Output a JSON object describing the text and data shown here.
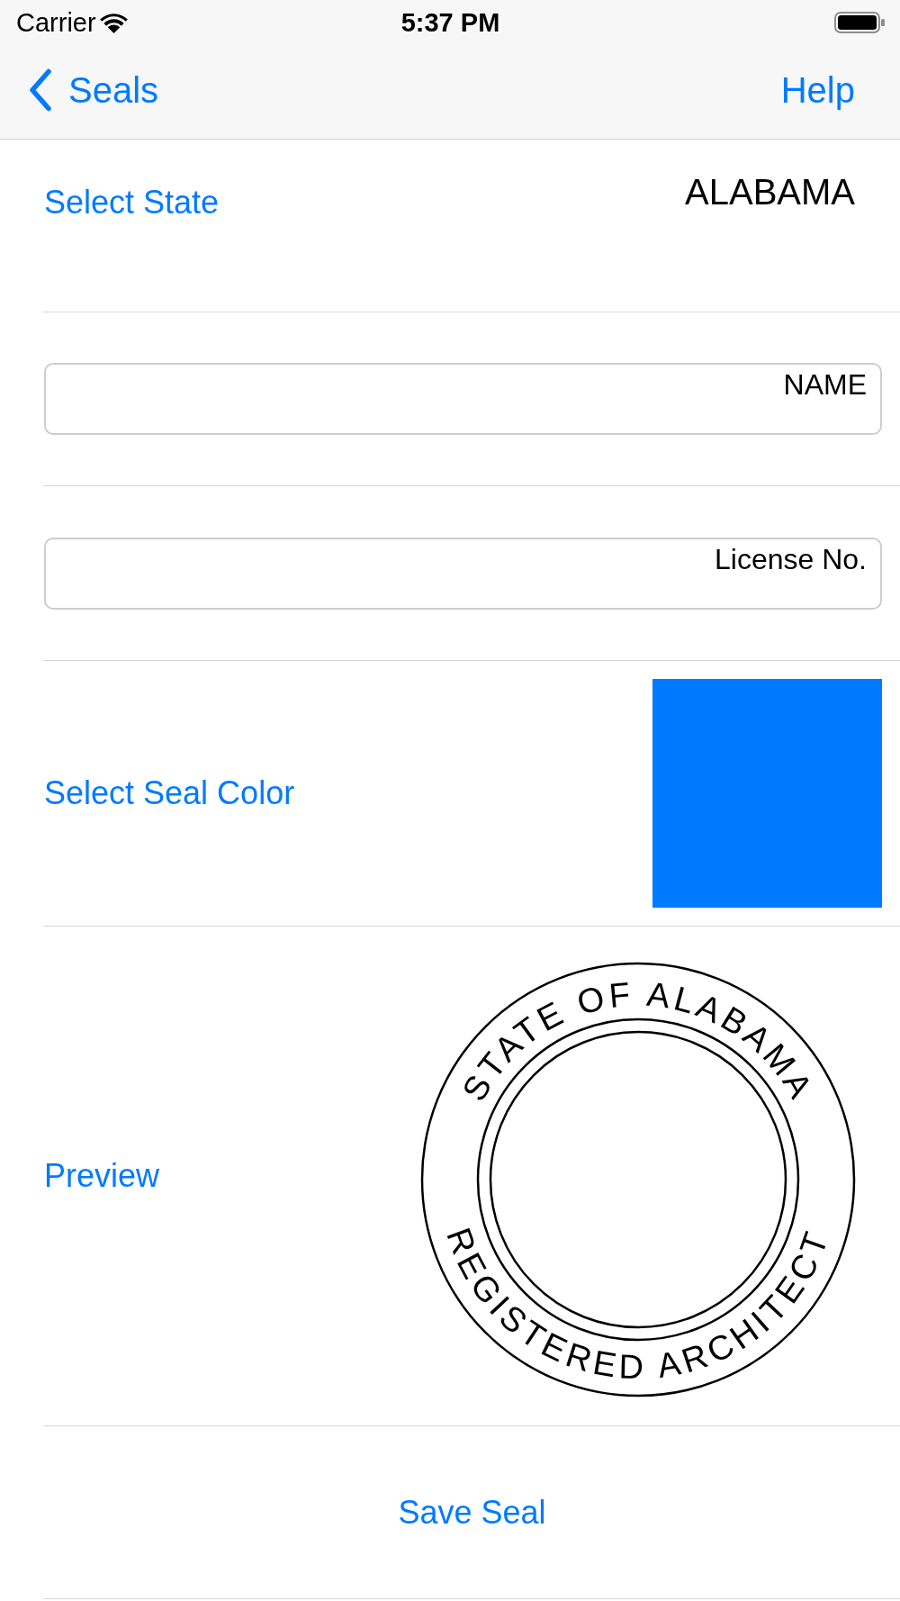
{
  "status_bar": {
    "carrier": "Carrier",
    "time": "5:37 PM"
  },
  "nav_bar": {
    "back_label": "Seals",
    "action_label": "Help"
  },
  "state_row": {
    "label": "Select State",
    "value": "ALABAMA"
  },
  "name_field": {
    "placeholder": "NAME"
  },
  "license_field": {
    "placeholder": "License No."
  },
  "seal_color_row": {
    "label": "Select Seal Color",
    "color": "#007aff"
  },
  "preview_row": {
    "label": "Preview",
    "seal": {
      "top_text": "STATE OF ALABAMA",
      "bottom_text": "REGISTERED ARCHITECT"
    }
  },
  "save_button": {
    "label": "Save Seal"
  }
}
